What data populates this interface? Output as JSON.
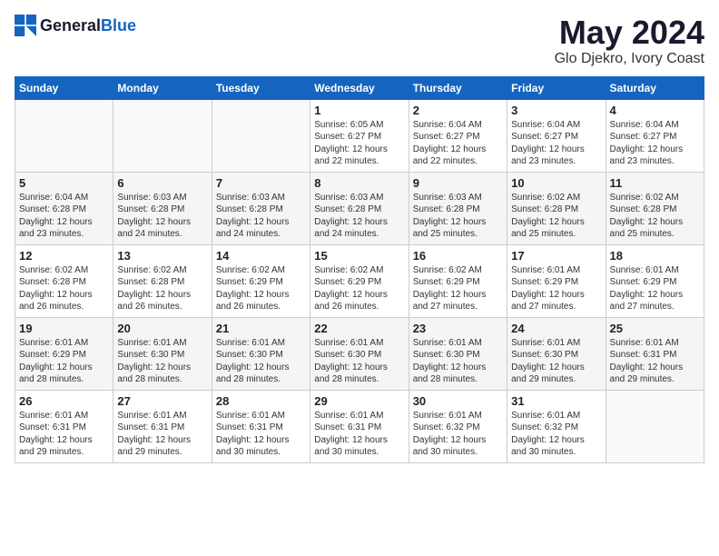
{
  "header": {
    "logo_general": "General",
    "logo_blue": "Blue",
    "month": "May 2024",
    "location": "Glo Djekro, Ivory Coast"
  },
  "days_of_week": [
    "Sunday",
    "Monday",
    "Tuesday",
    "Wednesday",
    "Thursday",
    "Friday",
    "Saturday"
  ],
  "weeks": [
    [
      {
        "day": "",
        "info": ""
      },
      {
        "day": "",
        "info": ""
      },
      {
        "day": "",
        "info": ""
      },
      {
        "day": "1",
        "info": "Sunrise: 6:05 AM\nSunset: 6:27 PM\nDaylight: 12 hours\nand 22 minutes."
      },
      {
        "day": "2",
        "info": "Sunrise: 6:04 AM\nSunset: 6:27 PM\nDaylight: 12 hours\nand 22 minutes."
      },
      {
        "day": "3",
        "info": "Sunrise: 6:04 AM\nSunset: 6:27 PM\nDaylight: 12 hours\nand 23 minutes."
      },
      {
        "day": "4",
        "info": "Sunrise: 6:04 AM\nSunset: 6:27 PM\nDaylight: 12 hours\nand 23 minutes."
      }
    ],
    [
      {
        "day": "5",
        "info": "Sunrise: 6:04 AM\nSunset: 6:28 PM\nDaylight: 12 hours\nand 23 minutes."
      },
      {
        "day": "6",
        "info": "Sunrise: 6:03 AM\nSunset: 6:28 PM\nDaylight: 12 hours\nand 24 minutes."
      },
      {
        "day": "7",
        "info": "Sunrise: 6:03 AM\nSunset: 6:28 PM\nDaylight: 12 hours\nand 24 minutes."
      },
      {
        "day": "8",
        "info": "Sunrise: 6:03 AM\nSunset: 6:28 PM\nDaylight: 12 hours\nand 24 minutes."
      },
      {
        "day": "9",
        "info": "Sunrise: 6:03 AM\nSunset: 6:28 PM\nDaylight: 12 hours\nand 25 minutes."
      },
      {
        "day": "10",
        "info": "Sunrise: 6:02 AM\nSunset: 6:28 PM\nDaylight: 12 hours\nand 25 minutes."
      },
      {
        "day": "11",
        "info": "Sunrise: 6:02 AM\nSunset: 6:28 PM\nDaylight: 12 hours\nand 25 minutes."
      }
    ],
    [
      {
        "day": "12",
        "info": "Sunrise: 6:02 AM\nSunset: 6:28 PM\nDaylight: 12 hours\nand 26 minutes."
      },
      {
        "day": "13",
        "info": "Sunrise: 6:02 AM\nSunset: 6:28 PM\nDaylight: 12 hours\nand 26 minutes."
      },
      {
        "day": "14",
        "info": "Sunrise: 6:02 AM\nSunset: 6:29 PM\nDaylight: 12 hours\nand 26 minutes."
      },
      {
        "day": "15",
        "info": "Sunrise: 6:02 AM\nSunset: 6:29 PM\nDaylight: 12 hours\nand 26 minutes."
      },
      {
        "day": "16",
        "info": "Sunrise: 6:02 AM\nSunset: 6:29 PM\nDaylight: 12 hours\nand 27 minutes."
      },
      {
        "day": "17",
        "info": "Sunrise: 6:01 AM\nSunset: 6:29 PM\nDaylight: 12 hours\nand 27 minutes."
      },
      {
        "day": "18",
        "info": "Sunrise: 6:01 AM\nSunset: 6:29 PM\nDaylight: 12 hours\nand 27 minutes."
      }
    ],
    [
      {
        "day": "19",
        "info": "Sunrise: 6:01 AM\nSunset: 6:29 PM\nDaylight: 12 hours\nand 28 minutes."
      },
      {
        "day": "20",
        "info": "Sunrise: 6:01 AM\nSunset: 6:30 PM\nDaylight: 12 hours\nand 28 minutes."
      },
      {
        "day": "21",
        "info": "Sunrise: 6:01 AM\nSunset: 6:30 PM\nDaylight: 12 hours\nand 28 minutes."
      },
      {
        "day": "22",
        "info": "Sunrise: 6:01 AM\nSunset: 6:30 PM\nDaylight: 12 hours\nand 28 minutes."
      },
      {
        "day": "23",
        "info": "Sunrise: 6:01 AM\nSunset: 6:30 PM\nDaylight: 12 hours\nand 28 minutes."
      },
      {
        "day": "24",
        "info": "Sunrise: 6:01 AM\nSunset: 6:30 PM\nDaylight: 12 hours\nand 29 minutes."
      },
      {
        "day": "25",
        "info": "Sunrise: 6:01 AM\nSunset: 6:31 PM\nDaylight: 12 hours\nand 29 minutes."
      }
    ],
    [
      {
        "day": "26",
        "info": "Sunrise: 6:01 AM\nSunset: 6:31 PM\nDaylight: 12 hours\nand 29 minutes."
      },
      {
        "day": "27",
        "info": "Sunrise: 6:01 AM\nSunset: 6:31 PM\nDaylight: 12 hours\nand 29 minutes."
      },
      {
        "day": "28",
        "info": "Sunrise: 6:01 AM\nSunset: 6:31 PM\nDaylight: 12 hours\nand 30 minutes."
      },
      {
        "day": "29",
        "info": "Sunrise: 6:01 AM\nSunset: 6:31 PM\nDaylight: 12 hours\nand 30 minutes."
      },
      {
        "day": "30",
        "info": "Sunrise: 6:01 AM\nSunset: 6:32 PM\nDaylight: 12 hours\nand 30 minutes."
      },
      {
        "day": "31",
        "info": "Sunrise: 6:01 AM\nSunset: 6:32 PM\nDaylight: 12 hours\nand 30 minutes."
      },
      {
        "day": "",
        "info": ""
      }
    ]
  ]
}
